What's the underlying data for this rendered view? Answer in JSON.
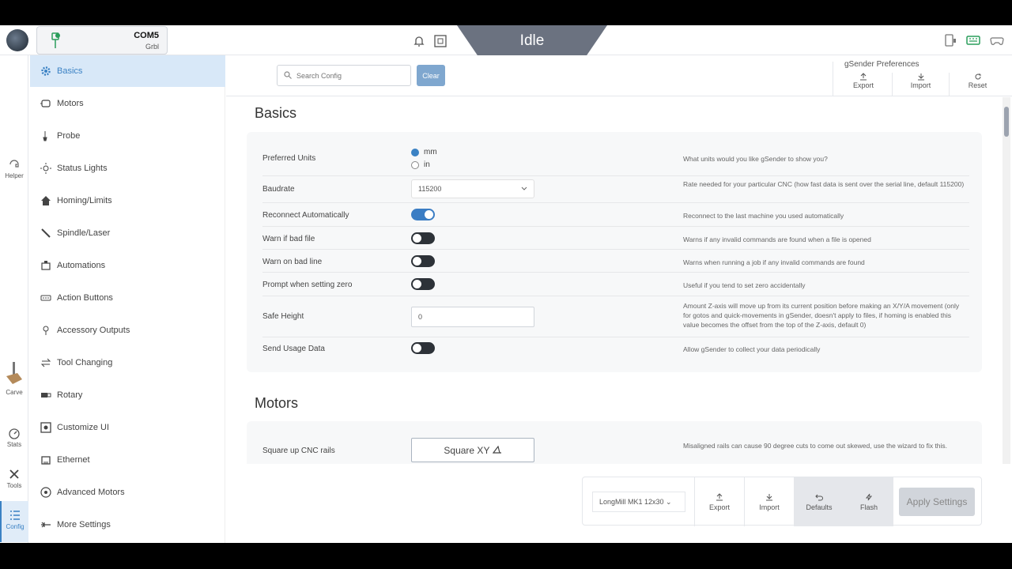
{
  "connection": {
    "port": "COM5",
    "firmware": "Grbl"
  },
  "status": {
    "state": "Idle"
  },
  "rail": [
    {
      "label": "Helper",
      "icon": "helper-icon"
    },
    {
      "label": "Carve",
      "icon": "carve-icon"
    },
    {
      "label": "Stats",
      "icon": "stats-icon"
    },
    {
      "label": "Tools",
      "icon": "tools-icon"
    },
    {
      "label": "Config",
      "icon": "config-icon"
    }
  ],
  "sidebar": {
    "items": [
      {
        "label": "Basics",
        "icon": "gear-icon"
      },
      {
        "label": "Motors",
        "icon": "motor-icon"
      },
      {
        "label": "Probe",
        "icon": "probe-icon"
      },
      {
        "label": "Status Lights",
        "icon": "light-icon"
      },
      {
        "label": "Homing/Limits",
        "icon": "home-icon"
      },
      {
        "label": "Spindle/Laser",
        "icon": "spindle-icon"
      },
      {
        "label": "Automations",
        "icon": "automation-icon"
      },
      {
        "label": "Action Buttons",
        "icon": "buttons-icon"
      },
      {
        "label": "Accessory Outputs",
        "icon": "output-icon"
      },
      {
        "label": "Tool Changing",
        "icon": "swap-icon"
      },
      {
        "label": "Rotary",
        "icon": "rotary-icon"
      },
      {
        "label": "Customize UI",
        "icon": "customize-icon"
      },
      {
        "label": "Ethernet",
        "icon": "ethernet-icon"
      },
      {
        "label": "Advanced Motors",
        "icon": "advanced-motor-icon"
      },
      {
        "label": "More Settings",
        "icon": "more-icon"
      }
    ]
  },
  "header": {
    "search_placeholder": "Search Config",
    "clear_label": "Clear",
    "prefs_title": "gSender Preferences",
    "export_label": "Export",
    "import_label": "Import",
    "reset_label": "Reset"
  },
  "basics": {
    "title": "Basics",
    "units": {
      "label": "Preferred Units",
      "opt_mm": "mm",
      "opt_in": "in",
      "desc": "What units would you like gSender to show you?"
    },
    "baudrate": {
      "label": "Baudrate",
      "value": "115200",
      "desc": "Rate needed for your particular CNC (how fast data is sent over the serial line, default 115200)"
    },
    "reconnect": {
      "label": "Reconnect Automatically",
      "desc": "Reconnect to the last machine you used automatically"
    },
    "warn_file": {
      "label": "Warn if bad file",
      "desc": "Warns if any invalid commands are found when a file is opened"
    },
    "warn_line": {
      "label": "Warn on bad line",
      "desc": "Warns when running a job if any invalid commands are found"
    },
    "prompt_zero": {
      "label": "Prompt when setting zero",
      "desc": "Useful if you tend to set zero accidentally"
    },
    "safe_height": {
      "label": "Safe Height",
      "value": "0",
      "desc": "Amount Z-axis will move up from its current position before making an X/Y/A movement (only for gotos and quick-movements in gSender, doesn't apply to files, if homing is enabled this value becomes the offset from the top of the Z-axis, default 0)"
    },
    "usage": {
      "label": "Send Usage Data",
      "desc": "Allow gSender to collect your data periodically"
    }
  },
  "motors": {
    "title": "Motors",
    "square": {
      "label": "Square up CNC rails",
      "button": "Square XY",
      "desc": "Misaligned rails can cause 90 degree cuts to come out skewed, use the wizard to fix this."
    }
  },
  "footer": {
    "machine": "LongMill MK1 12x30",
    "export_label": "Export",
    "import_label": "Import",
    "defaults_label": "Defaults",
    "flash_label": "Flash",
    "apply_label": "Apply Settings"
  },
  "colors": {
    "accent": "#3b82c4",
    "banner": "#6b7280"
  }
}
